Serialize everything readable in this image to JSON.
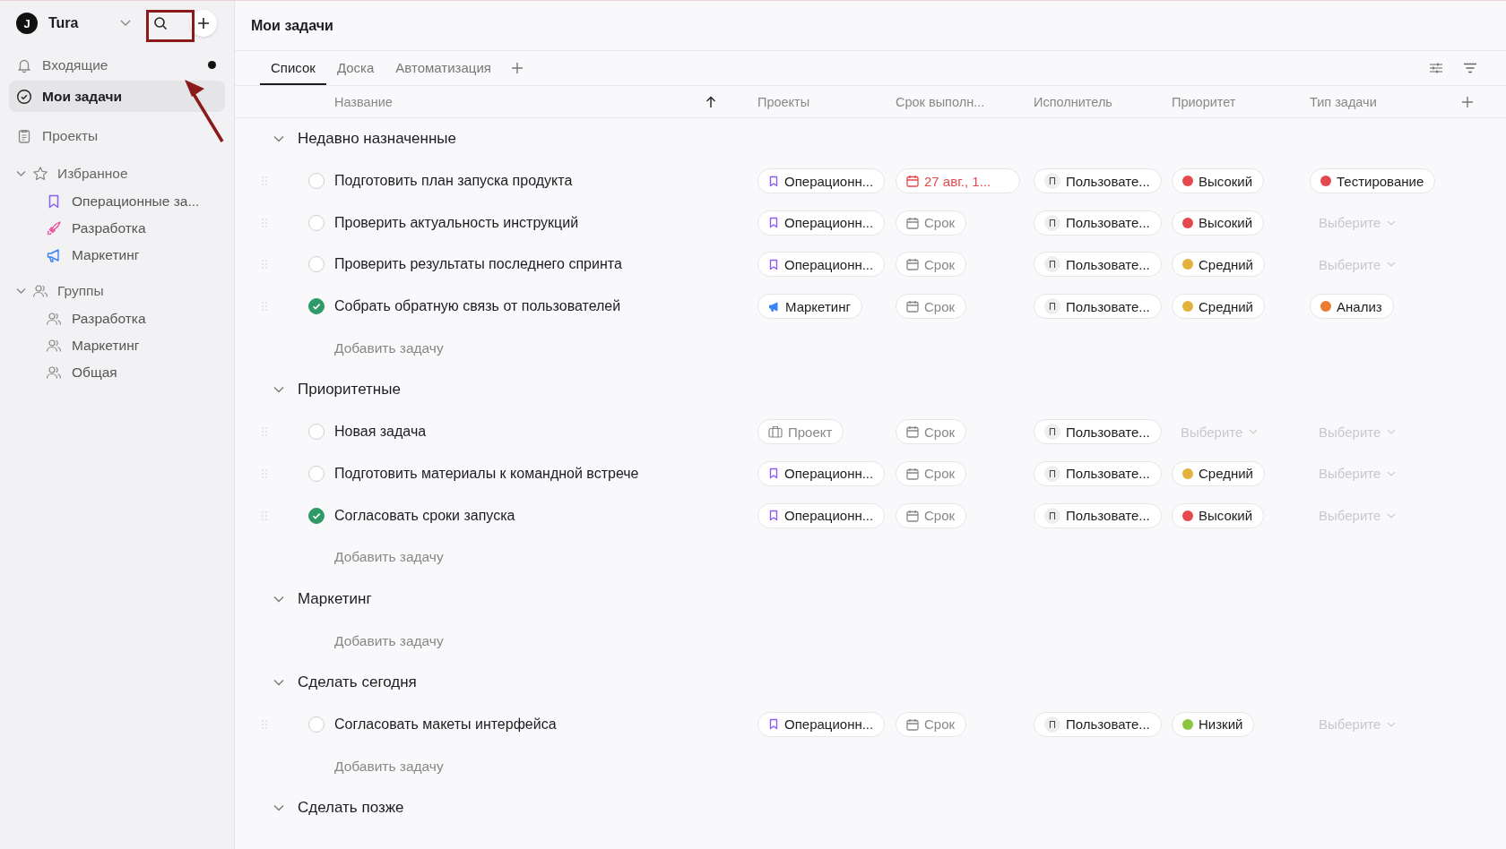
{
  "workspace": {
    "initial": "J",
    "name": "Tura"
  },
  "sidebar": {
    "items": [
      {
        "label": "Входящие",
        "selected": false,
        "unread": true
      },
      {
        "label": "Мои задачи",
        "selected": true,
        "unread": false
      },
      {
        "label": "Проекты",
        "selected": false,
        "unread": false
      }
    ],
    "sections": [
      {
        "label": "Избранное",
        "expanded": true,
        "children": [
          {
            "label": "Операционные за...",
            "color": "#8b5cf6"
          },
          {
            "label": "Разработка",
            "color": "#ec4899"
          },
          {
            "label": "Маркетинг",
            "color": "#3b82f6"
          }
        ]
      },
      {
        "label": "Группы",
        "expanded": true,
        "children": [
          {
            "label": "Разработка"
          },
          {
            "label": "Маркетинг"
          },
          {
            "label": "Общая"
          }
        ]
      }
    ]
  },
  "page": {
    "title": "Мои задачи"
  },
  "tabs": [
    {
      "label": "Список",
      "selected": true
    },
    {
      "label": "Доска",
      "selected": false
    },
    {
      "label": "Автоматизация",
      "selected": false
    }
  ],
  "columns": [
    "Название",
    "Проекты",
    "Срок выполн...",
    "Исполнитель",
    "Приоритет",
    "Тип задачи"
  ],
  "groups": [
    {
      "title": "Недавно назначенные",
      "expanded": true,
      "add_label": "Добавить задачу",
      "tasks": [
        {
          "name": "Подготовить план запуска продукта",
          "done": false,
          "project": {
            "kind": "bookmark",
            "label": "Операционн..."
          },
          "due": {
            "kind": "date",
            "label": "27 авг., 1..."
          },
          "assignee": {
            "initial": "П",
            "label": "Пользовате..."
          },
          "priority": {
            "kind": "pill",
            "label": "Высокий",
            "color": "#e5484d"
          },
          "type": {
            "kind": "pill",
            "label": "Тестирование",
            "color": "#e5484d"
          }
        },
        {
          "name": "Проверить актуальность инструкций",
          "done": false,
          "project": {
            "kind": "bookmark",
            "label": "Операционн..."
          },
          "due": {
            "kind": "empty",
            "label": "Срок"
          },
          "assignee": {
            "initial": "П",
            "label": "Пользовате..."
          },
          "priority": {
            "kind": "pill",
            "label": "Высокий",
            "color": "#e5484d"
          },
          "type": {
            "kind": "select",
            "label": "Выберите"
          }
        },
        {
          "name": "Проверить результаты последнего спринта",
          "done": false,
          "project": {
            "kind": "bookmark",
            "label": "Операционн..."
          },
          "due": {
            "kind": "empty",
            "label": "Срок"
          },
          "assignee": {
            "initial": "П",
            "label": "Пользовате..."
          },
          "priority": {
            "kind": "pill",
            "label": "Средний",
            "color": "#e3b23c"
          },
          "type": {
            "kind": "select",
            "label": "Выберите"
          }
        },
        {
          "name": "Собрать обратную связь от пользователей",
          "done": true,
          "project": {
            "kind": "megaphone",
            "label": "Маркетинг"
          },
          "due": {
            "kind": "empty",
            "label": "Срок"
          },
          "assignee": {
            "initial": "П",
            "label": "Пользовате..."
          },
          "priority": {
            "kind": "pill",
            "label": "Средний",
            "color": "#e3b23c"
          },
          "type": {
            "kind": "pill",
            "label": "Анализ",
            "color": "#ec7a30"
          }
        }
      ]
    },
    {
      "title": "Приоритетные",
      "expanded": true,
      "add_label": "Добавить задачу",
      "tasks": [
        {
          "name": "Новая задача",
          "done": false,
          "project": {
            "kind": "empty",
            "label": "Проект"
          },
          "due": {
            "kind": "empty",
            "label": "Срок"
          },
          "assignee": {
            "initial": "П",
            "label": "Пользовате..."
          },
          "priority": {
            "kind": "select",
            "label": "Выберите"
          },
          "type": {
            "kind": "select",
            "label": "Выберите"
          }
        },
        {
          "name": "Подготовить материалы к командной встрече",
          "done": false,
          "project": {
            "kind": "bookmark",
            "label": "Операционн..."
          },
          "due": {
            "kind": "empty",
            "label": "Срок"
          },
          "assignee": {
            "initial": "П",
            "label": "Пользовате..."
          },
          "priority": {
            "kind": "pill",
            "label": "Средний",
            "color": "#e3b23c"
          },
          "type": {
            "kind": "select",
            "label": "Выберите"
          }
        },
        {
          "name": "Согласовать сроки запуска",
          "done": true,
          "project": {
            "kind": "bookmark",
            "label": "Операционн..."
          },
          "due": {
            "kind": "empty",
            "label": "Срок"
          },
          "assignee": {
            "initial": "П",
            "label": "Пользовате..."
          },
          "priority": {
            "kind": "pill",
            "label": "Высокий",
            "color": "#e5484d"
          },
          "type": {
            "kind": "select",
            "label": "Выберите"
          }
        }
      ]
    },
    {
      "title": "Маркетинг",
      "expanded": true,
      "add_label": "Добавить задачу"
    },
    {
      "title": "Сделать сегодня",
      "expanded": true,
      "add_label": "Добавить задачу",
      "tasks": [
        {
          "name": "Согласовать макеты интерфейса",
          "done": false,
          "project": {
            "kind": "bookmark",
            "label": "Операционн..."
          },
          "due": {
            "kind": "empty",
            "label": "Срок"
          },
          "assignee": {
            "initial": "П",
            "label": "Пользовате..."
          },
          "priority": {
            "kind": "pill",
            "label": "Низкий",
            "color": "#8cc63f"
          },
          "type": {
            "kind": "select",
            "label": "Выберите"
          }
        }
      ]
    },
    {
      "title": "Сделать позже",
      "expanded": true
    }
  ]
}
